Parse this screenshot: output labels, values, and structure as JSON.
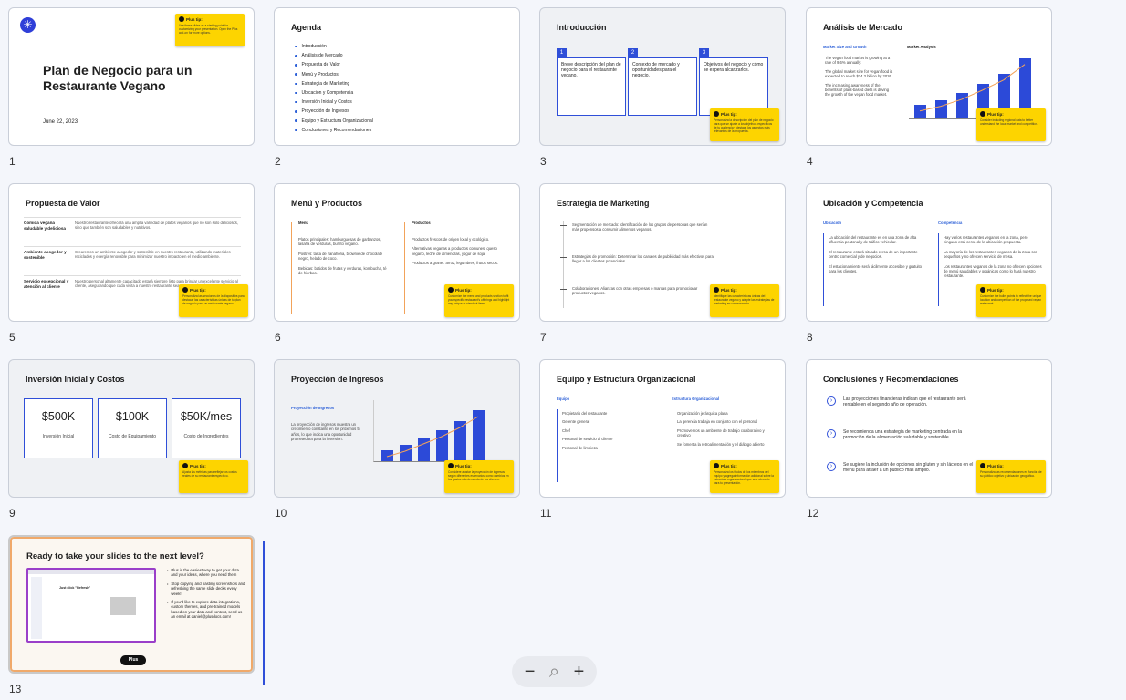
{
  "slides": [
    {
      "n": "1",
      "title": "Plan de Negocio para un Restaurante Vegano",
      "date": "June 22, 2023",
      "tip_head": "Plus tip:",
      "tip_body": "Use these slides as a starting point for customizing your presentation. Open the Plus add-on for more options."
    },
    {
      "n": "2",
      "title": "Agenda",
      "items": [
        "Introducción",
        "Análisis de Mercado",
        "Propuesta de Valor",
        "Menú y Productos",
        "Estrategia de Marketing",
        "Ubicación y Competencia",
        "Inversión Inicial y Costos",
        "Proyección de Ingresos",
        "Equipo y Estructura Organizacional",
        "Conclusiones y Recomendaciones"
      ]
    },
    {
      "n": "3",
      "title": "Introducción",
      "cols": [
        {
          "k": "1",
          "t": "Breve descripción del plan de negocio para el restaurante vegano."
        },
        {
          "k": "2",
          "t": "Contexto de mercado y oportunidades para el negocio."
        },
        {
          "k": "3",
          "t": "Objetivos del negocio y cómo se espera alcanzarlos."
        }
      ],
      "tip_head": "Plus tip:",
      "tip_body": "Personaliza la descripción del plan de negocio para que se ajuste a los objetivos específicos de tu audiencia y destaca los aspectos más relevantes de la propuesta."
    },
    {
      "n": "4",
      "title": "Análisis de Mercado",
      "left_head": "Market Size and Growth",
      "right_head": "Market Analysis",
      "bullets": [
        "The vegan food market is growing at a rate of 9.6% annually.",
        "The global market size for vegan food is expected to reach $24.3 billion by 2026.",
        "The increasing awareness of the benefits of plant-based diets is driving the growth of the vegan food market."
      ],
      "tip_head": "Plus tip:",
      "tip_body": "Consider including regional data to better understand the local market and competition."
    },
    {
      "n": "5",
      "title": "Propuesta de Valor",
      "rows": [
        {
          "k": "Comida vegana saludable y deliciosa",
          "v": "Nuestro restaurante ofrecerá una amplia variedad de platos veganos que no son solo deliciosos, sino que también son saludables y nutritivos."
        },
        {
          "k": "Ambiente acogedor y sostenible",
          "v": "Crearemos un ambiente acogedor y sostenible en nuestro restaurante, utilizando materiales reciclados y energía renovable para minimizar nuestro impacto en el medio ambiente."
        },
        {
          "k": "Servicio excepcional y atención al cliente",
          "v": "Nuestro personal altamente capacitado estará siempre listo para brindar un excelente servicio al cliente, asegurando que cada visita a nuestro restaurante sea una experiencia memorable."
        }
      ],
      "tip_head": "Plus tip:",
      "tip_body": "Personaliza las secciones de la diapositiva para destacar las características únicas de tu plan de negocio para un restaurante vegano."
    },
    {
      "n": "6",
      "title": "Menú y Productos",
      "col1_head": "Menú",
      "col1": [
        "Platos principales: hamburguesas de garbanzos, lasaña de verduras, burrito vegano.",
        "Postres: tarta de zanahoria, brownie de chocolate negro, helado de coco.",
        "Bebidas: batidos de frutas y verduras, kombucha, té de hierbas."
      ],
      "col2_head": "Productos",
      "col2": [
        "Productos frescos de origen local y ecológico.",
        "Alternativas veganas a productos comunes: queso vegano, leche de almendras, yogur de soja.",
        "Productos a granel: arroz, legumbres, frutos secos."
      ],
      "tip_head": "Plus tip:",
      "tip_body": "Customize the menu and products section to fit your specific restaurant's offerings and highlight any unique or standout items."
    },
    {
      "n": "7",
      "title": "Estrategia de Marketing",
      "items": [
        "Segmentación de mercado: Identificación de los grupos de personas que serían más propensos a consumir alimentos veganos.",
        "Estrategias de promoción: Determinar los canales de publicidad más efectivos para llegar a los clientes potenciales.",
        "Colaboraciones: Alianzas con otras empresas o marcas para promocionar productos veganos."
      ],
      "tip_head": "Plus tip:",
      "tip_body": "Identifique las características únicas del restaurante vegano y adapte las estrategias de marketing en consecuencia."
    },
    {
      "n": "8",
      "title": "Ubicación y Competencia",
      "col1_head": "Ubicación",
      "col1": [
        "La ubicación del restaurante es en una zona de alta afluencia peatonal y de tráfico vehicular.",
        "El restaurante estará situado cerca de un importante centro comercial y de negocios.",
        "El estacionamiento será fácilmente accesible y gratuito para los clientes."
      ],
      "col2_head": "Competencia",
      "col2": [
        "Hay varios restaurantes veganos en la zona, pero ninguno está cerca de la ubicación propuesta.",
        "La mayoría de los restaurantes veganos de la zona son pequeños y no ofrecen servicio de mesa.",
        "Los restaurantes veganos de la zona no ofrecen opciones de menú saludables y orgánicas como lo hará nuestro restaurante."
      ],
      "tip_head": "Plus tip:",
      "tip_body": "Customize the bullet points to reflect the unique location and competition of the proposed vegan restaurant."
    },
    {
      "n": "9",
      "title": "Inversión Inicial y Costos",
      "cards": [
        {
          "v": "$500K",
          "l": "Inversión Inicial"
        },
        {
          "v": "$100K",
          "l": "Costo de Equipamiento"
        },
        {
          "v": "$50K/mes",
          "l": "Costo de Ingredientes"
        }
      ],
      "tip_head": "Plus tip:",
      "tip_body": "Ajusta las métricas para reflejar los costos reales de su restaurante específico."
    },
    {
      "n": "10",
      "title": "Proyección de Ingresos",
      "sub": "Proyección de Ingresos",
      "body": "La proyección de ingresos muestra un crecimiento constante en los próximos 5 años, lo que indica una oportunidad prometedora para la inversión.",
      "tip_head": "Plus tip:",
      "tip_body": "Considere ajustar la proyección de ingresos según diferentes escenarios, como cambios en los gastos o la demanda de los clientes."
    },
    {
      "n": "11",
      "title": "Equipo y Estructura Organizacional",
      "col1_head": "Equipo",
      "col1": [
        "Propietario del restaurante",
        "Gerente general",
        "Chef",
        "Personal de servicio al cliente",
        "Personal de limpieza"
      ],
      "col2_head": "Estructura Organizacional",
      "col2": [
        "Organización jerárquica plana",
        "La gerencia trabaja en conjunto con el personal",
        "Promovemos un ambiente de trabajo colaborativo y creativo",
        "Se fomenta la retroalimentación y el diálogo abierto"
      ],
      "tip_head": "Plus tip:",
      "tip_body": "Personaliza los títulos de los miembros del equipo y agrega información adicional sobre la estructura organizacional que sea relevante para tu presentación."
    },
    {
      "n": "12",
      "title": "Conclusiones y Recomendaciones",
      "items": [
        "Las proyecciones financieras indican que el restaurante será rentable en el segundo año de operación.",
        "Se recomienda una estrategia de marketing centrada en la promoción de la alimentación saludable y sostenible.",
        "Se sugiere la inclusión de opciones sin gluten y sin lácteos en el menú para atraer a un público más amplio."
      ],
      "tip_head": "Plus tip:",
      "tip_body": "Personaliza las recomendaciones en función de su público objetivo y ubicación geográfica."
    },
    {
      "n": "13",
      "title": "Ready to take your slides to the next level?",
      "shot_caption": "Just click \"Refresh\"",
      "bullets": [
        "Plus is the easiest way to get your data and your ideas, where you need them",
        "Stop copying and pasting screenshots and refreshing the same slide decks every week!",
        "If you'd like to explore data integrations, custom themes, and pre-trained models based on your data and content, send us an email at daniel@plusdocs.com!"
      ],
      "badge": "Plus"
    }
  ],
  "chart10_values": [
    12,
    18,
    26,
    34,
    44,
    56
  ],
  "chart4_values": [
    18,
    24,
    33,
    45,
    58,
    78
  ],
  "zoom": {
    "out": "−",
    "icon": "⌕",
    "in": "+"
  }
}
